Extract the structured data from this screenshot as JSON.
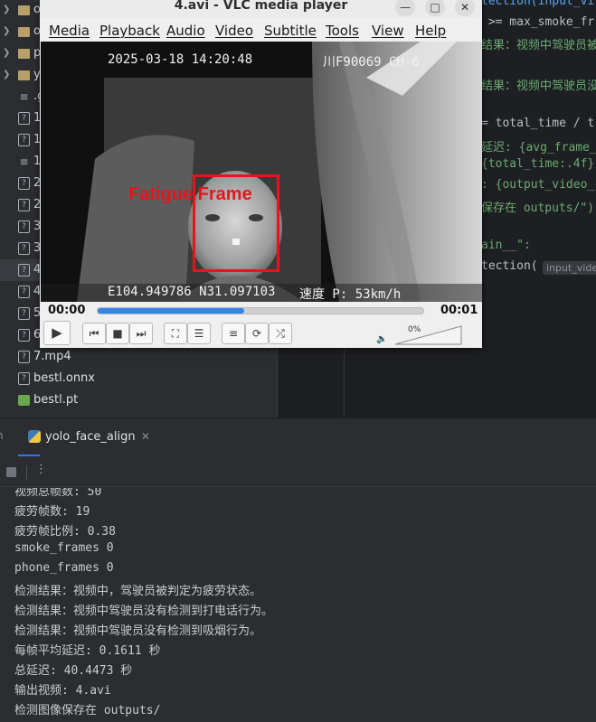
{
  "file_tree": [
    {
      "name": "o",
      "type": "folder",
      "expandable": true
    },
    {
      "name": "o",
      "type": "folder",
      "expandable": true
    },
    {
      "name": "p",
      "type": "folder",
      "expandable": true
    },
    {
      "name": "y",
      "type": "folder",
      "expandable": true
    },
    {
      "name": ".g",
      "type": "text"
    },
    {
      "name": "1",
      "type": "unknown"
    },
    {
      "name": "1",
      "type": "unknown"
    },
    {
      "name": "1",
      "type": "text"
    },
    {
      "name": "2",
      "type": "unknown"
    },
    {
      "name": "2",
      "type": "unknown"
    },
    {
      "name": "3",
      "type": "unknown"
    },
    {
      "name": "3",
      "type": "unknown"
    },
    {
      "name": "4",
      "type": "unknown",
      "selected": true
    },
    {
      "name": "4",
      "type": "unknown"
    },
    {
      "name": "5",
      "type": "unknown"
    },
    {
      "name": "6",
      "type": "unknown"
    },
    {
      "name": "7.mp4",
      "type": "unknown"
    },
    {
      "name": "bestl.onnx",
      "type": "unknown"
    },
    {
      "name": "bestl.pt",
      "type": "pt"
    }
  ],
  "editor": {
    "lines": [
      {
        "text": "tection(input_vi",
        "cls": "fn"
      },
      {
        "text": " >= max_smoke_fr",
        "cls": ""
      },
      {
        "text": "结果：视频中驾驶员被",
        "cls": "str"
      },
      {
        "text": "",
        "cls": ""
      },
      {
        "text": "结果：视频中驾驶员没",
        "cls": "str"
      },
      {
        "text": "",
        "cls": ""
      },
      {
        "text": "= total_time / t",
        "cls": ""
      },
      {
        "text": "延迟: {avg_frame_",
        "cls": "str"
      },
      {
        "text": "{total_time:.4f}",
        "cls": "str"
      },
      {
        "text": ": {output_video_",
        "cls": "str"
      },
      {
        "text": "保存在 outputs/\")",
        "cls": "str"
      },
      {
        "text": "",
        "cls": ""
      },
      {
        "text": "ain__\":",
        "cls": "str"
      },
      {
        "text": "tection(",
        "cls": ""
      }
    ],
    "param_hint": "input_vide"
  },
  "vlc": {
    "title": "4.avi - VLC media player",
    "menu": [
      "Media",
      "Playback",
      "Audio",
      "Video",
      "Subtitle",
      "Tools",
      "View",
      "Help"
    ],
    "osd_datetime": "2025-03-18 14:20:48",
    "osd_plate": "川F90069 CH-6",
    "osd_coords": "E104.949786 N31.097103",
    "osd_speed": "速度 P: 53km/h",
    "detection_label": "Fatigue Frame",
    "time_elapsed": "00:00",
    "time_total": "00:01",
    "progress": 0.45,
    "volume": "0%",
    "colors": {
      "detection": "#e8141c",
      "progress": "#3584e4"
    }
  },
  "run_panel": {
    "tab_label": "yolo_face_align",
    "console": [
      "视频总帧数: 50",
      "疲劳帧数: 19",
      "疲劳帧比例: 0.38",
      "smoke_frames 0",
      "phone_frames 0",
      "检测结果：视频中，驾驶员被判定为疲劳状态。",
      "检测结果：视频中驾驶员没有检测到打电话行为。",
      "检测结果：视频中驾驶员没有检测到吸烟行为。",
      "每帧平均延迟: 0.1611 秒",
      "总延迟: 40.4473 秒",
      "输出视频: 4.avi",
      "检测图像保存在 outputs/"
    ]
  }
}
